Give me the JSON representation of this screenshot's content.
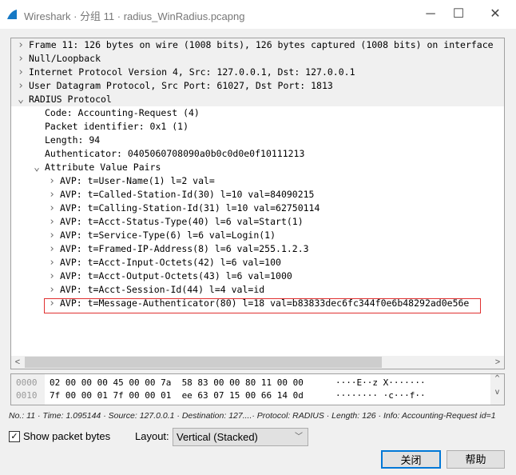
{
  "window": {
    "title": "Wireshark · 分组 11 · radius_WinRadius.pcapng"
  },
  "tree": [
    {
      "text": "Frame 11: 126 bytes on wire (1008 bits), 126 bytes captured (1008 bits) on interface",
      "level": 0,
      "expanded": false
    },
    {
      "text": "Null/Loopback",
      "level": 0,
      "expanded": false
    },
    {
      "text": "Internet Protocol Version 4, Src: 127.0.0.1, Dst: 127.0.0.1",
      "level": 0,
      "expanded": false
    },
    {
      "text": "User Datagram Protocol, Src Port: 61027, Dst Port: 1813",
      "level": 0,
      "expanded": false
    },
    {
      "text": "RADIUS Protocol",
      "level": 0,
      "expanded": true
    },
    {
      "text": "Code: Accounting-Request (4)",
      "level": 1
    },
    {
      "text": "Packet identifier: 0x1 (1)",
      "level": 1
    },
    {
      "text": "Length: 94",
      "level": 1
    },
    {
      "text": "Authenticator: 0405060708090a0b0c0d0e0f10111213",
      "level": 1
    },
    {
      "text": "Attribute Value Pairs",
      "level": 1,
      "expanded": true
    },
    {
      "text": "AVP: t=User-Name(1) l=2 val=",
      "level": 2,
      "expanded": false
    },
    {
      "text": "AVP: t=Called-Station-Id(30) l=10 val=84090215",
      "level": 2,
      "expanded": false
    },
    {
      "text": "AVP: t=Calling-Station-Id(31) l=10 val=62750114",
      "level": 2,
      "expanded": false
    },
    {
      "text": "AVP: t=Acct-Status-Type(40) l=6 val=Start(1)",
      "level": 2,
      "expanded": false
    },
    {
      "text": "AVP: t=Service-Type(6) l=6 val=Login(1)",
      "level": 2,
      "expanded": false
    },
    {
      "text": "AVP: t=Framed-IP-Address(8) l=6 val=255.1.2.3",
      "level": 2,
      "expanded": false
    },
    {
      "text": "AVP: t=Acct-Input-Octets(42) l=6 val=100",
      "level": 2,
      "expanded": false
    },
    {
      "text": "AVP: t=Acct-Output-Octets(43) l=6 val=1000",
      "level": 2,
      "expanded": false
    },
    {
      "text": "AVP: t=Acct-Session-Id(44) l=4 val=id",
      "level": 2,
      "expanded": false
    },
    {
      "text": "AVP: t=Message-Authenticator(80) l=18 val=b83833dec6fc344f0e6b48292ad0e56e",
      "level": 2,
      "expanded": false,
      "highlighted": true
    }
  ],
  "hex": [
    {
      "offset": "0000",
      "bytes": "02 00 00 00 45 00 00 7a  58 83 00 00 80 11 00 00",
      "ascii": "····E··z X·······"
    },
    {
      "offset": "0010",
      "bytes": "7f 00 00 01 7f 00 00 01  ee 63 07 15 00 66 14 0d",
      "ascii": "········ ·c···f··"
    }
  ],
  "status": "No.: 11 · Time: 1.095144 · Source: 127.0.0.1 · Destination: 127....· Protocol: RADIUS · Length: 126 · Info: Accounting-Request id=1",
  "show_bytes": {
    "label": "Show packet bytes",
    "checked": true
  },
  "layout": {
    "label": "Layout:",
    "value": "Vertical (Stacked)"
  },
  "buttons": {
    "close": "关闭",
    "help": "帮助"
  },
  "colors": {
    "highlight_border": "#e03030",
    "default_button": "#0078d7"
  }
}
